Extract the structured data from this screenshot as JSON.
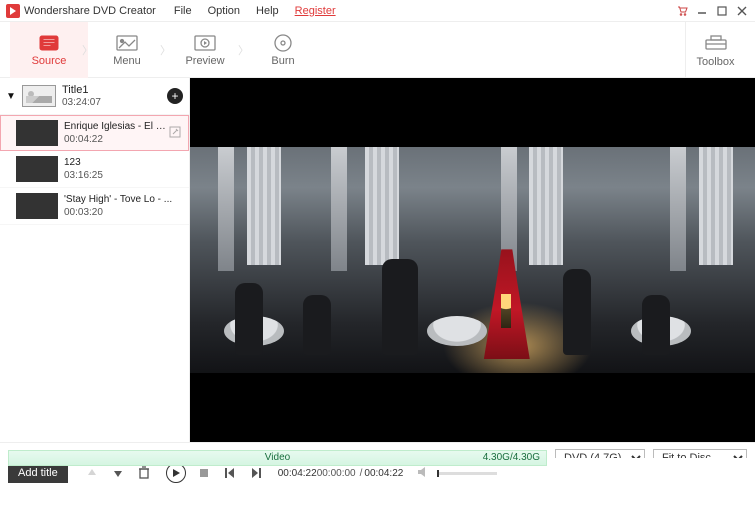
{
  "app": {
    "name": "Wondershare DVD Creator"
  },
  "menu": {
    "file": "File",
    "option": "Option",
    "help": "Help",
    "register": "Register"
  },
  "tabs": {
    "source": "Source",
    "menu": "Menu",
    "preview": "Preview",
    "burn": "Burn",
    "toolbox": "Toolbox"
  },
  "title": {
    "name": "Title1",
    "duration": "03:24:07"
  },
  "clips": [
    {
      "name": "Enrique Iglesias - El Per...",
      "duration": "00:04:22",
      "selected": true
    },
    {
      "name": "123",
      "duration": "03:16:25",
      "selected": false
    },
    {
      "name": "'Stay High' - Tove Lo - ...",
      "duration": "00:03:20",
      "selected": false
    }
  ],
  "controls": {
    "add_title": "Add title",
    "playhead_duration": "00:04:22",
    "time_current": "00:00:00",
    "time_total": "00:04:22"
  },
  "footer": {
    "capacity_label": "Video",
    "capacity_used": "4.30G",
    "capacity_total": "4.30G",
    "disc_type": "DVD (4.7G)",
    "fit_mode": "Fit to Disc"
  }
}
